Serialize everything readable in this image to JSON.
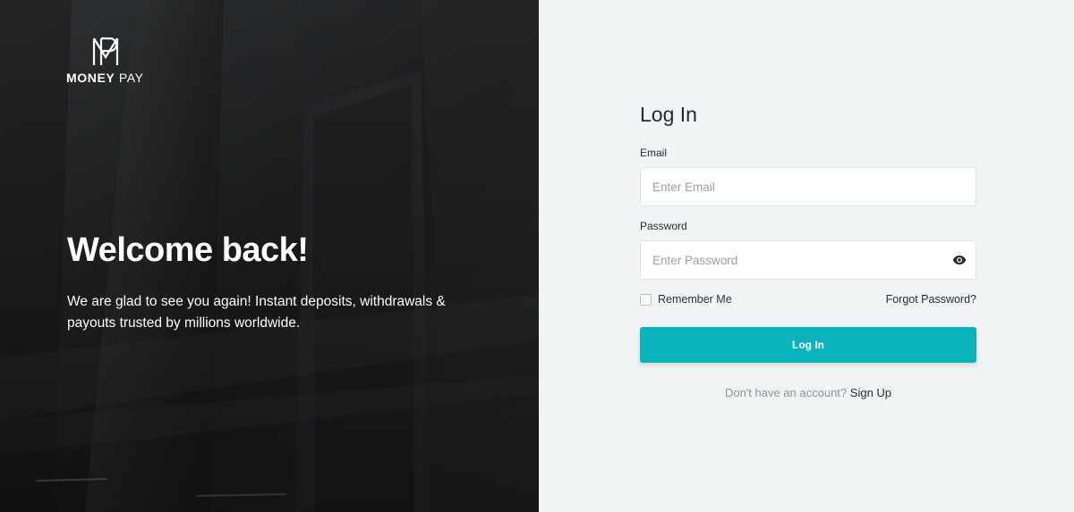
{
  "brand": {
    "name_bold": "MONEY",
    "name_regular": "PAY",
    "logo_icon": "mp-monogram-icon"
  },
  "hero": {
    "title": "Welcome back!",
    "subtitle": "We are glad to see you again! Instant deposits, withdrawals & payouts trusted by millions worldwide."
  },
  "login": {
    "title": "Log In",
    "email": {
      "label": "Email",
      "placeholder": "Enter Email",
      "value": ""
    },
    "password": {
      "label": "Password",
      "placeholder": "Enter Password",
      "value": "",
      "toggle_icon": "eye-icon"
    },
    "remember_me": {
      "label": "Remember Me",
      "checked": false
    },
    "forgot_password": "Forgot Password?",
    "submit_label": "Log In",
    "signup_prompt": "Don't have an account?",
    "signup_link": "Sign Up"
  },
  "colors": {
    "accent": "#0ab3bd",
    "panel_background": "#f1f4f5",
    "hero_background": "#1f2122",
    "text_dark": "#1f2a33"
  }
}
